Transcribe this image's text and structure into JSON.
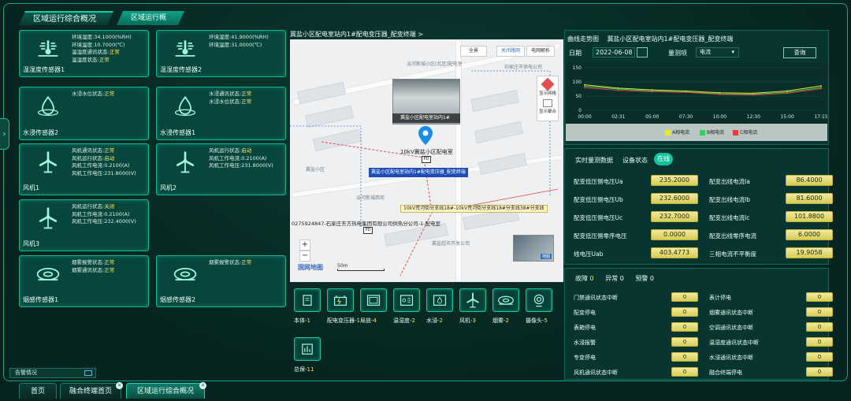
{
  "tabs": {
    "main": "区域运行综合概况",
    "sub": "区域运行概况"
  },
  "side_handle": "›",
  "cards": [
    {
      "name": "温湿度传感器1",
      "icon": "thermometer-icon",
      "lines": [
        {
          "k": "环境湿度:",
          "v": "34.1000(%RH)"
        },
        {
          "k": "环境温度:",
          "v": "10.7000(℃)"
        },
        {
          "k": "温湿度通讯状态:",
          "v": "正常"
        },
        {
          "k": "温湿度状态:",
          "v": "正常"
        }
      ]
    },
    {
      "name": "温湿度传感器2",
      "icon": "thermometer-icon",
      "lines": [
        {
          "k": "环境湿度:",
          "v": "41.9000(%RH)"
        },
        {
          "k": "环境温度:",
          "v": "31.0000(℃)"
        }
      ]
    },
    {
      "name": "水浸传感器2",
      "icon": "water-drop-icon",
      "lines": [
        {
          "k": "水浸水位状态:",
          "v": "正常"
        }
      ]
    },
    {
      "name": "水浸传感器1",
      "icon": "water-drop-icon",
      "lines": [
        {
          "k": "水浸通讯状态:",
          "v": "正常"
        },
        {
          "k": "水浸水位状态:",
          "v": "正常"
        }
      ]
    },
    {
      "name": "风机1",
      "icon": "fan-icon",
      "lines": [
        {
          "k": "风机通讯状态:",
          "v": "正常"
        },
        {
          "k": "风机运行状态:",
          "v": "启动"
        },
        {
          "k": "风机工作电流:",
          "v": "0.2100(A)"
        },
        {
          "k": "风机工作电压:",
          "v": "231.8000(V)"
        }
      ]
    },
    {
      "name": "风机2",
      "icon": "fan-icon",
      "lines": [
        {
          "k": "风机运行状态:",
          "v": "启动"
        },
        {
          "k": "风机工作电流:",
          "v": "0.2100(A)"
        },
        {
          "k": "风机工作电压:",
          "v": "231.8000(V)"
        }
      ]
    },
    {
      "name": "风机3",
      "icon": "fan-icon",
      "lines": [
        {
          "k": "风机运行状态:",
          "v": "关闭"
        },
        {
          "k": "风机工作电流:",
          "v": "0.2100(A)"
        },
        {
          "k": "风机工作电压:",
          "v": "232.4000(V)"
        }
      ]
    },
    {
      "name": "烟感传感器1",
      "icon": "smoke-detector-icon",
      "lines": [
        {
          "k": "烟雾报警状态:",
          "v": "正常"
        },
        {
          "k": "烟雾通讯状态:",
          "v": "正常"
        }
      ]
    },
    {
      "name": "烟感传感器2",
      "icon": "smoke-detector-icon",
      "lines": [
        {
          "k": "烟雾报警状态:",
          "v": "正常"
        }
      ]
    }
  ],
  "alarm_bar": "告警情况",
  "bottom_tabs": [
    "首页",
    "融合终端首页",
    "区域运行综合概况"
  ],
  "map": {
    "title": "冀盐小区配电室站内1#配电变压器_配变终端  >",
    "btn_full": "全景",
    "btn_roads": "关闭路网",
    "btn_grid": "电网解析",
    "layer_btn_1": "显示网格",
    "layer_btn_2": "显示聚合",
    "popup_caption": "冀盐小区配电室站内1#",
    "station_name": "10kV冀盐小区配电室",
    "pd": "PD",
    "blue_tag": "冀盐小区配电室站内1#配电变压器_配变终端",
    "yellow_tag": "10kV荒河街分支线18#-10kV荒河街分支线18#分支线38#分支线",
    "black_label": "0275924847-石家庄东方热电集团有限公司供热分公司-1-配电室",
    "labels": [
      "淡河新城小区(北区)配电室",
      "石家庄市供电公司",
      "冀盐小区",
      "淡河新城西苑",
      "冀盐超市开发公司"
    ],
    "logo": "国网地图",
    "scale": "50m",
    "zoom_in": "+",
    "zoom_out": "−",
    "minimap_label": "地图"
  },
  "devices": [
    {
      "icon": "terminal-icon",
      "label": "本体-",
      "n": "1"
    },
    {
      "icon": "transformer-icon",
      "label": "配电变压器-",
      "n": "1"
    },
    {
      "icon": "cabinet-icon",
      "label": "局放-",
      "n": "4"
    },
    {
      "icon": "thermometer-panel-icon",
      "label": "温湿度-",
      "n": "2"
    },
    {
      "icon": "water-sensor-icon",
      "label": "水浸-",
      "n": "2"
    },
    {
      "icon": "fan-icon",
      "label": "风机-",
      "n": "3"
    },
    {
      "icon": "smoke-detector-icon",
      "label": "烟雾-",
      "n": "2"
    },
    {
      "icon": "camera-icon",
      "label": "摄像头-",
      "n": "5"
    },
    {
      "icon": "meter-icon",
      "label": "总保-",
      "n": "11"
    }
  ],
  "trend": {
    "title": "曲线走势图",
    "subtitle": "冀盐小区配电室站内1#配电变压器_配变终端",
    "date_label": "日期",
    "date": "2022-06-08",
    "meas_label": "量测项",
    "meas_value": "电流",
    "query": "查询"
  },
  "chart_data": {
    "type": "line",
    "x": [
      "00:00",
      "02:31",
      "05:00",
      "07:30",
      "10:00",
      "12:30",
      "15:00",
      "17:15"
    ],
    "ylim": [
      0,
      150
    ],
    "yticks": [
      0,
      50,
      100,
      150
    ],
    "series": [
      {
        "name": "A相电流",
        "color": "#e6e633",
        "values": [
          90,
          78,
          72,
          68,
          62,
          60,
          68,
          86
        ]
      },
      {
        "name": "B相电流",
        "color": "#33d15e",
        "values": [
          85,
          75,
          68,
          65,
          58,
          57,
          64,
          80
        ]
      },
      {
        "name": "C相电流",
        "color": "#e04040",
        "values": [
          80,
          70,
          66,
          63,
          56,
          54,
          60,
          76
        ]
      }
    ]
  },
  "realtime": {
    "title": "实时量测数据",
    "device_status_label": "设备状态",
    "online": "在线",
    "left": [
      {
        "k": "配变低压侧电压Ua",
        "v": "235.2000"
      },
      {
        "k": "配变低压侧电压Ub",
        "v": "232.6000"
      },
      {
        "k": "配变低压侧电压Uc",
        "v": "232.7000"
      },
      {
        "k": "配变低压侧零序电压",
        "v": "0.0000"
      },
      {
        "k": "线电压Uab",
        "v": "403.4773"
      }
    ],
    "right": [
      {
        "k": "配变出线电流Ia",
        "v": "86.4000"
      },
      {
        "k": "配变出线电流Ib",
        "v": "81.6000"
      },
      {
        "k": "配变出线电流Ic",
        "v": "101.8800"
      },
      {
        "k": "配变出线零序电流",
        "v": "6.0000"
      },
      {
        "k": "三相电流不平衡度",
        "v": "19.9058"
      }
    ]
  },
  "faults": {
    "fault_label": "故障",
    "fault_n": "0",
    "abnormal_label": "异常",
    "abnormal_n": "0",
    "warn_label": "预警",
    "warn_n": "0",
    "left": [
      {
        "k": "门禁通讯状态中断",
        "v": "0"
      },
      {
        "k": "配变停电",
        "v": "0"
      },
      {
        "k": "表箱停电",
        "v": "0"
      },
      {
        "k": "水浸报警",
        "v": "0"
      },
      {
        "k": "专变停电",
        "v": "0"
      },
      {
        "k": "风机通讯状态中断",
        "v": "0"
      }
    ],
    "right": [
      {
        "k": "表计停电",
        "v": "0"
      },
      {
        "k": "烟雾通讯状态中断",
        "v": "0"
      },
      {
        "k": "空调通讯状态中断",
        "v": "0"
      },
      {
        "k": "温湿度通讯状态中断",
        "v": "0"
      },
      {
        "k": "水浸通讯状态中断",
        "v": "0"
      },
      {
        "k": "融合终端停电",
        "v": "0"
      }
    ]
  },
  "colors": {
    "accent": "#19c9a4",
    "value_bg": "#e6dc7a",
    "ok_text": "#ffe45c"
  }
}
